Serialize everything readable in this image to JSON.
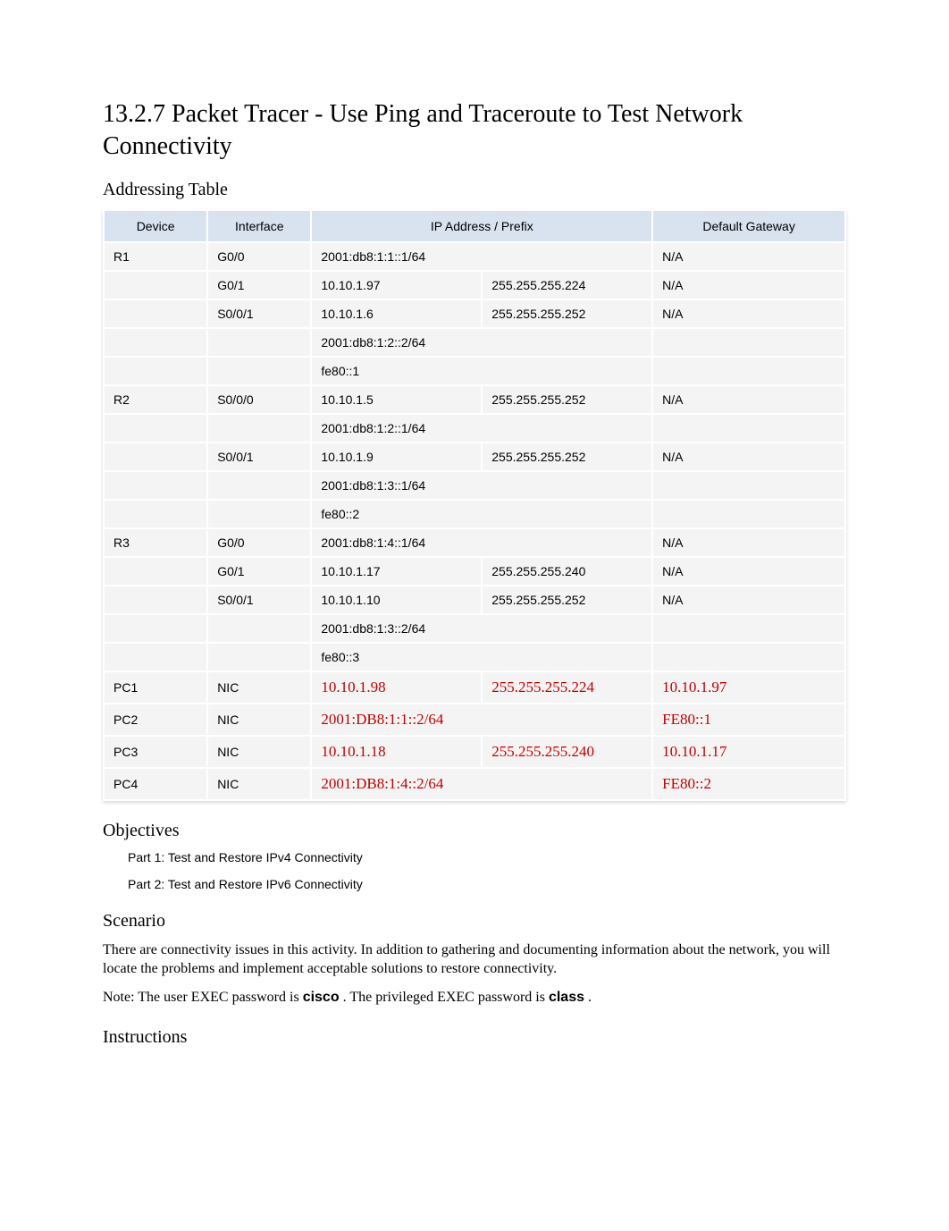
{
  "title": "13.2.7 Packet Tracer - Use Ping and Traceroute to Test Network Connectivity",
  "sections": {
    "addressing_table": "Addressing Table",
    "objectives": "Objectives",
    "scenario": "Scenario",
    "instructions": "Instructions"
  },
  "table": {
    "headers": {
      "device": "Device",
      "interface": "Interface",
      "ip_prefix": "IP Address / Prefix",
      "gateway": "Default Gateway"
    },
    "rows": [
      {
        "device": "R1",
        "iface": "G0/0",
        "addr": "2001:db8:1:1::1/64",
        "mask": "",
        "gw": "N/A",
        "span_addr": true
      },
      {
        "device": "",
        "iface": "G0/1",
        "addr": "10.10.1.97",
        "mask": "255.255.255.224",
        "gw": "N/A",
        "span_addr": false
      },
      {
        "device": "",
        "iface": "S0/0/1",
        "addr": "10.10.1.6",
        "mask": "255.255.255.252",
        "gw": "N/A",
        "span_addr": false
      },
      {
        "device": "",
        "iface": "",
        "addr": "2001:db8:1:2::2/64",
        "mask": "",
        "gw": "",
        "span_addr": true
      },
      {
        "device": "",
        "iface": "",
        "addr": "fe80::1",
        "mask": "",
        "gw": "",
        "span_addr": true
      },
      {
        "device": "R2",
        "iface": "S0/0/0",
        "addr": "10.10.1.5",
        "mask": "255.255.255.252",
        "gw": "N/A",
        "span_addr": false
      },
      {
        "device": "",
        "iface": "",
        "addr": "2001:db8:1:2::1/64",
        "mask": "",
        "gw": "",
        "span_addr": true
      },
      {
        "device": "",
        "iface": "S0/0/1",
        "addr": "10.10.1.9",
        "mask": "255.255.255.252",
        "gw": "N/A",
        "span_addr": false
      },
      {
        "device": "",
        "iface": "",
        "addr": "2001:db8:1:3::1/64",
        "mask": "",
        "gw": "",
        "span_addr": true
      },
      {
        "device": "",
        "iface": "",
        "addr": "fe80::2",
        "mask": "",
        "gw": "",
        "span_addr": true
      },
      {
        "device": "R3",
        "iface": "G0/0",
        "addr": "2001:db8:1:4::1/64",
        "mask": "",
        "gw": "N/A",
        "span_addr": true
      },
      {
        "device": "",
        "iface": "G0/1",
        "addr": "10.10.1.17",
        "mask": "255.255.255.240",
        "gw": "N/A",
        "span_addr": false
      },
      {
        "device": "",
        "iface": "S0/0/1",
        "addr": "10.10.1.10",
        "mask": "255.255.255.252",
        "gw": "N/A",
        "span_addr": false
      },
      {
        "device": "",
        "iface": "",
        "addr": "2001:db8:1:3::2/64",
        "mask": "",
        "gw": "",
        "span_addr": true
      },
      {
        "device": "",
        "iface": "",
        "addr": "fe80::3",
        "mask": "",
        "gw": "",
        "span_addr": true
      },
      {
        "device": "PC1",
        "iface": "NIC",
        "addr": "10.10.1.98",
        "mask": "255.255.255.224",
        "gw": "10.10.1.97",
        "span_addr": false,
        "red": true
      },
      {
        "device": "PC2",
        "iface": "NIC",
        "addr": "2001:DB8:1:1::2/64",
        "mask": "",
        "gw": "FE80::1",
        "span_addr": true,
        "red": true
      },
      {
        "device": "PC3",
        "iface": "NIC",
        "addr": "10.10.1.18",
        "mask": "255.255.255.240",
        "gw": "10.10.1.17",
        "span_addr": false,
        "red": true
      },
      {
        "device": "PC4",
        "iface": "NIC",
        "addr": "2001:DB8:1:4::2/64",
        "mask": "",
        "gw": "FE80::2",
        "span_addr": true,
        "red": true
      }
    ]
  },
  "objectives": {
    "part1": "Part 1: Test and Restore IPv4 Connectivity",
    "part2": "Part 2: Test and Restore IPv6 Connectivity"
  },
  "scenario": {
    "p1": "There are connectivity issues in this activity. In addition to gathering and documenting information about the network, you will locate the problems and implement acceptable solutions to restore connectivity.",
    "note_label": "Note:",
    "note_pre": " The user EXEC password is ",
    "pw1": "cisco",
    "note_mid": ". The privileged EXEC password is ",
    "pw2": "class",
    "note_end": "."
  }
}
